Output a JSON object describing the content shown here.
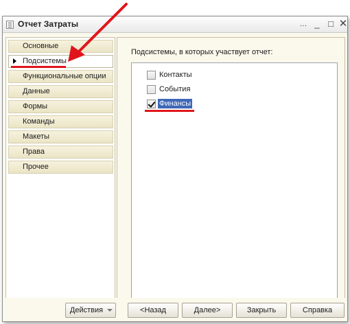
{
  "window": {
    "title": "Отчет Затраты",
    "controls": {
      "more": "…",
      "minimize": "_",
      "maximize": "□",
      "close": "✕"
    }
  },
  "nav": {
    "items": [
      {
        "label": "Основные",
        "active": false
      },
      {
        "label": "Подсистемы",
        "active": true
      },
      {
        "label": "Функциональные опции",
        "active": false
      },
      {
        "label": "Данные",
        "active": false
      },
      {
        "label": "Формы",
        "active": false
      },
      {
        "label": "Команды",
        "active": false
      },
      {
        "label": "Макеты",
        "active": false
      },
      {
        "label": "Права",
        "active": false
      },
      {
        "label": "Прочее",
        "active": false
      }
    ]
  },
  "panel": {
    "label": "Подсистемы, в которых участвует отчет:",
    "subsystems": [
      {
        "label": "Контакты",
        "checked": false,
        "selected": false
      },
      {
        "label": "События",
        "checked": false,
        "selected": false
      },
      {
        "label": "Финансы",
        "checked": true,
        "selected": true
      }
    ]
  },
  "buttons": {
    "actions": "Действия",
    "back": "<Назад",
    "next": "Далее>",
    "close": "Закрыть",
    "help": "Справка"
  },
  "colors": {
    "annotation_red": "#e0151b",
    "selection_blue": "#3e67b8",
    "panel_background": "#fbf8ec"
  }
}
